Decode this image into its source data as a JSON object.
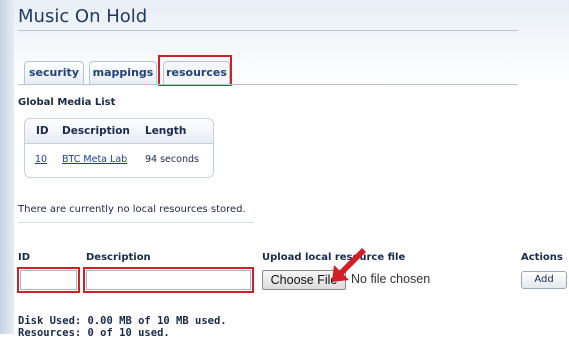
{
  "page": {
    "title": "Music On Hold"
  },
  "tabs": [
    {
      "label": "security"
    },
    {
      "label": "mappings"
    },
    {
      "label": "resources"
    }
  ],
  "global_media": {
    "heading": "Global Media List",
    "columns": [
      "ID",
      "Description",
      "Length"
    ],
    "rows": [
      {
        "id": "10",
        "description": "BTC Meta Lab",
        "length": "94 seconds"
      }
    ]
  },
  "local": {
    "empty_message": "There are currently no local resources stored."
  },
  "form": {
    "id_label": "ID",
    "description_label": "Description",
    "upload_label": "Upload local resource file",
    "actions_label": "Actions",
    "choose_file_label": "Choose File",
    "file_status": "No file chosen",
    "add_label": "Add",
    "id_value": "",
    "description_value": ""
  },
  "disk": {
    "used": "Disk Used: 0.00 MB of 10 MB used.",
    "resources": "Resources: 0 of 10 used."
  },
  "colors": {
    "highlight": "#d21f26",
    "link": "#1b3f9c"
  }
}
